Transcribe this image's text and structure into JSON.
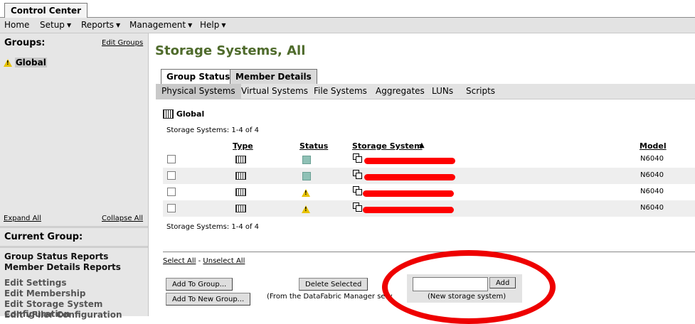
{
  "app": {
    "tab_label": "Control Center"
  },
  "menu": {
    "home": "Home",
    "setup": "Setup",
    "reports": "Reports",
    "management": "Management",
    "help": "Help"
  },
  "sidebar": {
    "groups_heading": "Groups:",
    "edit_groups": "Edit Groups",
    "global_label": "Global",
    "expand_all": "Expand All",
    "collapse_all": "Collapse All",
    "current_group_heading": "Current Group:",
    "reports": [
      "Group Status Reports",
      "Member Details Reports"
    ],
    "edits": [
      "Edit Settings",
      "Edit Membership",
      "Edit Storage System Configuration",
      "Edit vFiler Configuration"
    ]
  },
  "page": {
    "title": "Storage Systems, All",
    "primary_tabs": [
      "Group Status",
      "Member Details"
    ],
    "sub_tabs": [
      "Physical Systems",
      "Virtual Systems",
      "File Systems",
      "Aggregates",
      "LUNs",
      "Scripts"
    ]
  },
  "table": {
    "group_title": "Global",
    "count_text": "Storage Systems:  1-4 of 4",
    "headers": {
      "type": "Type",
      "status": "Status",
      "storage_system": "Storage System",
      "model": "Model"
    },
    "sort_indicator": "▲",
    "rows": [
      {
        "status": "normal",
        "model": "N6040"
      },
      {
        "status": "normal",
        "model": "N6040"
      },
      {
        "status": "warning",
        "model": "N6040"
      },
      {
        "status": "warning",
        "model": "N6040"
      }
    ]
  },
  "actions": {
    "select_all": "Select All",
    "separator": " - ",
    "unselect_all": "Unselect All",
    "add_to_group": "Add To Group...",
    "add_to_new_group": "Add To New Group...",
    "delete_selected": "Delete Selected",
    "delete_note": "(From the DataFabric Manager serv",
    "add_button": "Add",
    "add_hint": "(New storage system)",
    "new_system_value": ""
  },
  "colors": {
    "title_green": "#4f6b2c",
    "status_ok": "#8fc1b6",
    "warning_yellow": "#e8c300",
    "annotation_red": "#ee0000"
  }
}
